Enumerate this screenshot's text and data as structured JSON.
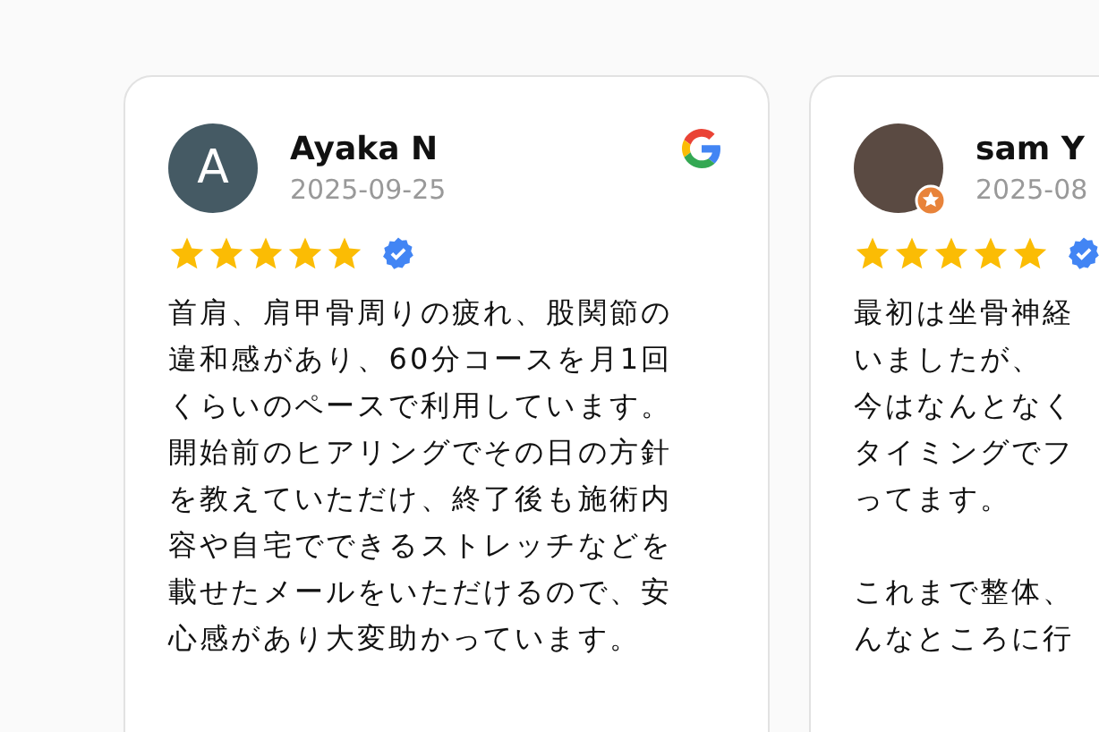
{
  "reviews": [
    {
      "name": "Ayaka N",
      "date": "2025-09-25",
      "avatar": {
        "kind": "initial",
        "letter": "A"
      },
      "source_logo": true,
      "stars": 5,
      "verified": true,
      "paragraphs": [
        [
          "首肩、肩甲骨周りの疲れ、股関節の",
          "違和感があり、60分コースを月1回",
          "くらいのペースで利用しています。",
          "開始前のヒアリングでその日の方針",
          "を教えていただけ、終了後も施術内",
          "容や自宅でできるストレッチなどを",
          "載せたメールをいただけるので、安",
          "心感があり大変助かっています。"
        ]
      ]
    },
    {
      "name": "sam Y",
      "date": "2025-08",
      "avatar": {
        "kind": "photo"
      },
      "source_logo": false,
      "stars": 5,
      "verified": true,
      "paragraphs": [
        [
          "最初は坐骨神経",
          "いましたが、",
          "今はなんとなく",
          "タイミングでフ",
          "ってます。"
        ],
        [
          "これまで整体、",
          "んなところに行"
        ]
      ]
    }
  ]
}
